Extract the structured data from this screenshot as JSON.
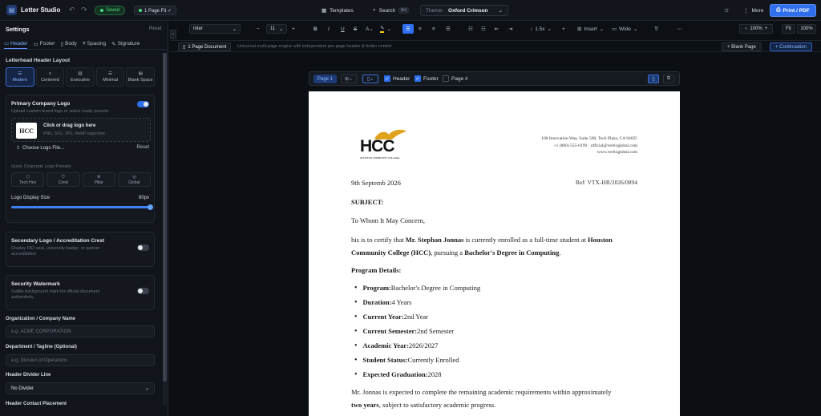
{
  "app": {
    "title": "Letter Studio",
    "saved": "Saved",
    "fit": "1 Page Fit ✓"
  },
  "topbar": {
    "templates": "Templates",
    "search": "Search",
    "search_kbd": "⌘K",
    "theme_label": "Theme:",
    "theme_value": "Oxford Crimson",
    "more": "More",
    "print": "Print / PDF"
  },
  "sidebar": {
    "title": "Settings",
    "reset": "Reset",
    "tabs": [
      {
        "label": "Header"
      },
      {
        "label": "Footer"
      },
      {
        "label": "Body"
      },
      {
        "label": "Spacing"
      },
      {
        "label": "Signature"
      }
    ],
    "layout_title": "Letterhead Header Layout",
    "layouts": [
      {
        "label": "Modern"
      },
      {
        "label": "Centered"
      },
      {
        "label": "Executive"
      },
      {
        "label": "Minimal"
      },
      {
        "label": "Blank Space"
      }
    ],
    "primary_logo": {
      "title": "Primary Company Logo",
      "sub": "Upload custom brand logo or select ready presets",
      "drop_title": "Click or drag logo here",
      "drop_sub": "PNG, SVG, JPG, WebP supported",
      "choose": "Choose Logo File...",
      "reset": "Reset",
      "logo_text": "HCC",
      "presets_label": "Quick Corporate Logo Presets:",
      "presets": [
        {
          "label": "Tech Hex"
        },
        {
          "label": "Crest"
        },
        {
          "label": "Pillar"
        },
        {
          "label": "Global"
        }
      ],
      "size_label": "Logo Display Size",
      "size_value": "80px",
      "size_fraction": 1.0
    },
    "secondary": {
      "title": "Secondary Logo / Accreditation Crest",
      "sub": "Display ISO seal, university badge, or partner accreditation"
    },
    "watermark": {
      "title": "Security Watermark",
      "sub": "Subtle background mark for official document authenticity"
    },
    "org_label": "Organization / Company Name",
    "org_placeholder": "e.g. ACME CORPORATION",
    "dept_label": "Department / Tagline (Optional)",
    "dept_placeholder": "e.g. Division of Operations",
    "divider_label": "Header Divider Line",
    "divider_value": "No Divider",
    "contact_label": "Header Contact Placement"
  },
  "format": {
    "font": "Inter",
    "size": "11",
    "spacing": "1.5x",
    "insert": "Insert",
    "width": "Wide",
    "zoom": "100%",
    "fit": "Fit",
    "zoom2": "100%"
  },
  "docbar": {
    "tab": "1 Page Document",
    "desc": "Universal multi-page engine with independent per-page header & footer control",
    "blank": "+ Blank Page",
    "continuation": "+ Continuation"
  },
  "pagebar": {
    "page": "Page 1",
    "header": "Header",
    "footer": "Footer",
    "pagenum": "Page #"
  },
  "letter": {
    "logo_text": "HCC",
    "logo_sub": "HOUSTON COMMUNITY COLLEGE",
    "address": [
      "100 Innovation Way, Suite 500, Tech Plaza, CA 94025",
      "+1 (800) 555-0199 · official@vertixglobal.com",
      "www.vertixglobal.com"
    ],
    "date": "9th Septemb 2026",
    "ref": "Ref: VTX-HR/2026/0894",
    "subject": "SUBJECT:",
    "salutation": "To Whom It May Concern,",
    "p1_a": "his is to certify that ",
    "p1_b": "Mr. Stephan Jonnas",
    "p1_c": " is currently enrolled as a full-time student at ",
    "p1_d": "Houston",
    "p1_e": "Community College (HCC)",
    "p1_f": ", pursuing a ",
    "p1_g": "Bachelor's Degree in Computing",
    "p1_h": ".",
    "program_heading": "Program Details:",
    "details": [
      {
        "key": "Program:",
        "value": " Bachelor's Degree in Computing"
      },
      {
        "key": "Duration:",
        "value": " 4 Years"
      },
      {
        "key": "Current Year:",
        "value": " 2nd Year"
      },
      {
        "key": "Current Semester:",
        "value": " 2nd Semester"
      },
      {
        "key": "Academic Year:",
        "value": " 2026/2027"
      },
      {
        "key": "Student Status:",
        "value": " Currently Enrolled"
      },
      {
        "key": "Expected Graduation:",
        "value": " 2028"
      }
    ],
    "p2_a": "Mr. Jonnas is expected to complete the remaining academic requirements within approximately",
    "p2_b": "two years",
    "p2_c": ", subject to satisfactory academic progress."
  }
}
